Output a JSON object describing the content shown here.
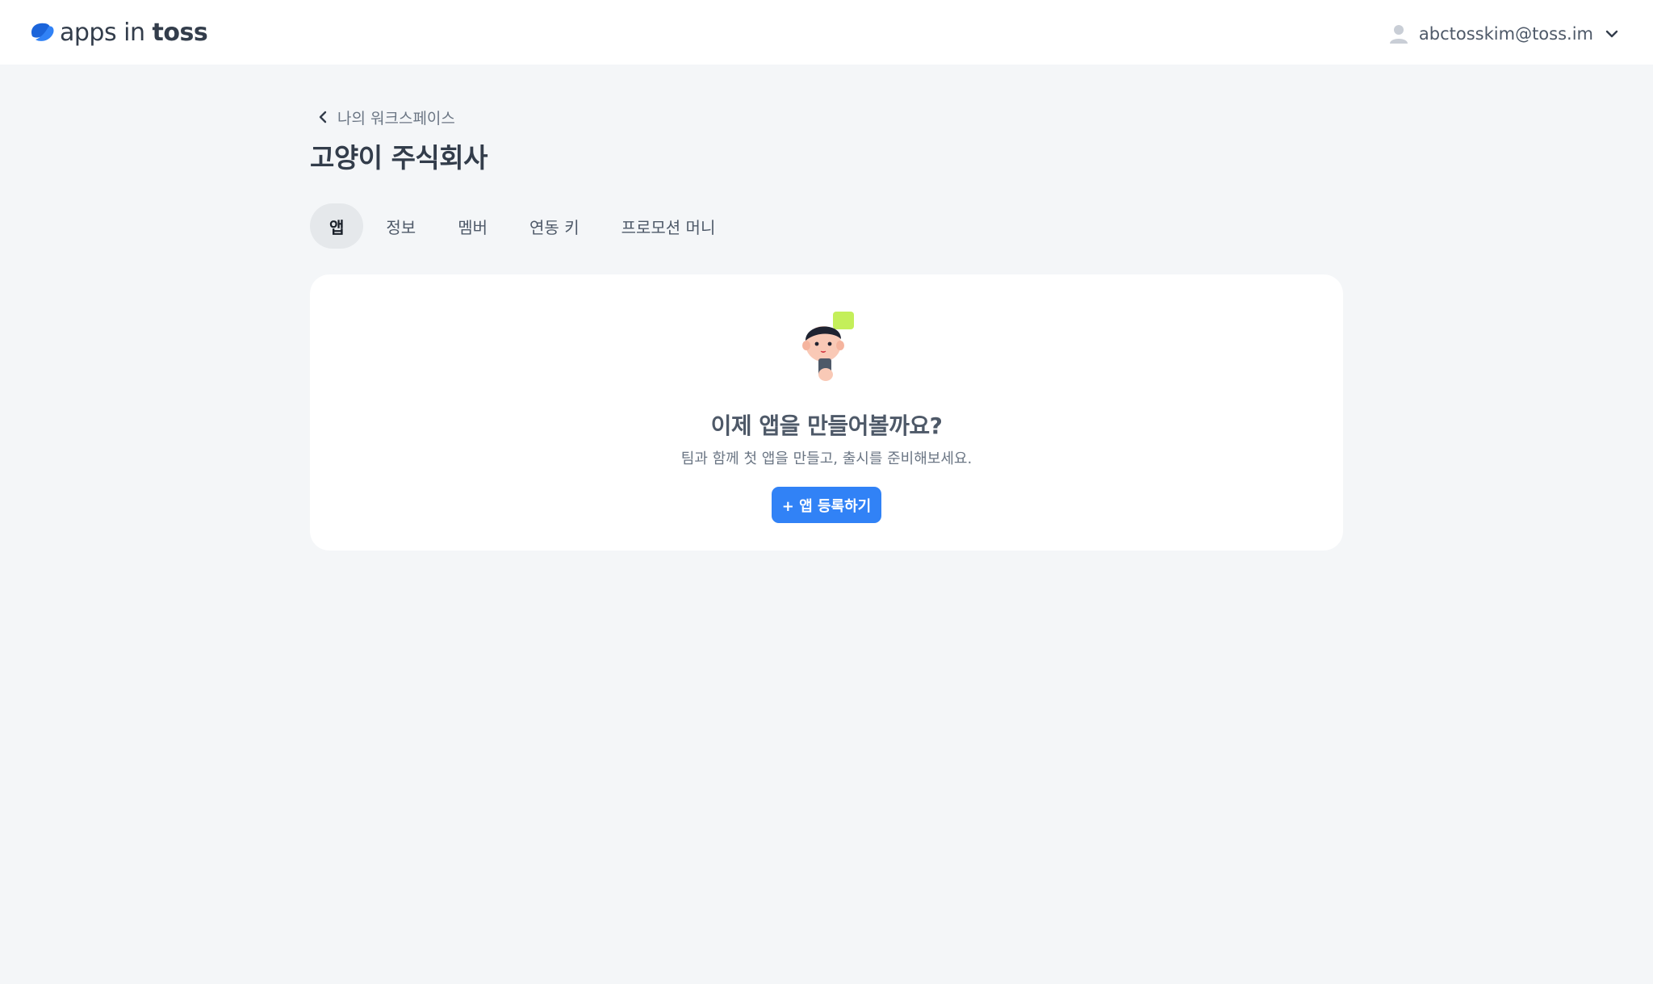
{
  "header": {
    "logo": {
      "text_light": "apps in ",
      "text_bold": "toss",
      "icon": "toss-logo-mark"
    },
    "account": {
      "icon": "user-icon",
      "email": "abctosskim@toss.im",
      "dropdown_icon": "chevron-down-icon"
    }
  },
  "breadcrumb": {
    "icon": "chevron-left-icon",
    "label": "나의 워크스페이스"
  },
  "page_title": "고양이 주식회사",
  "tabs": [
    {
      "label": "앱",
      "active": true
    },
    {
      "label": "정보",
      "active": false
    },
    {
      "label": "멤버",
      "active": false
    },
    {
      "label": "연동 키",
      "active": false
    },
    {
      "label": "프로모션 머니",
      "active": false
    }
  ],
  "empty_state": {
    "illustration": "person-with-phone-illustration",
    "title": "이제 앱을 만들어볼까요?",
    "description": "팀과 함께 첫 앱을 만들고, 출시를 준비해보세요.",
    "button_label": "+ 앱 등록하기"
  },
  "colors": {
    "background": "#f4f6f8",
    "card": "#ffffff",
    "primary": "#3182f6",
    "active_tab": "#e5e8eb"
  }
}
